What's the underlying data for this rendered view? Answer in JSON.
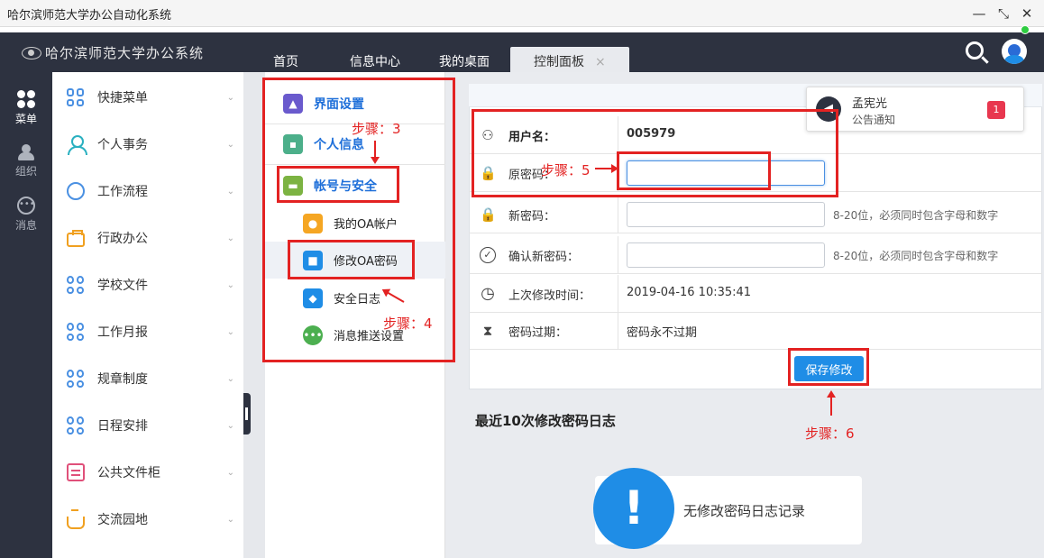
{
  "window": {
    "title": "哈尔滨师范大学办公自动化系统",
    "min_glyph": "—",
    "max_glyph": "⤡",
    "close_glyph": "✕"
  },
  "topnav": {
    "logo": "哈尔滨师范大学办公系统",
    "tabs": [
      {
        "label": "首页"
      },
      {
        "label": "信息中心"
      },
      {
        "label": "我的桌面"
      },
      {
        "label": "控制面板",
        "active": true
      }
    ],
    "tab_close_glyph": "×"
  },
  "strip": [
    {
      "label": "菜单",
      "icon": "grid-icon"
    },
    {
      "label": "组织",
      "icon": "people-icon"
    },
    {
      "label": "消息",
      "icon": "chat-icon"
    }
  ],
  "menu": {
    "items": [
      {
        "label": "快捷菜单",
        "icon": "grid-icon"
      },
      {
        "label": "个人事务",
        "icon": "person-icon"
      },
      {
        "label": "工作流程",
        "icon": "flow-icon"
      },
      {
        "label": "行政办公",
        "icon": "briefcase-icon"
      },
      {
        "label": "学校文件",
        "icon": "grid-icon"
      },
      {
        "label": "工作月报",
        "icon": "grid-icon"
      },
      {
        "label": "规章制度",
        "icon": "grid-icon"
      },
      {
        "label": "日程安排",
        "icon": "grid-icon"
      },
      {
        "label": "公共文件柜",
        "icon": "cabinet-icon"
      },
      {
        "label": "交流园地",
        "icon": "cup-icon"
      }
    ],
    "chevron": "⌄"
  },
  "subnav": {
    "sections": [
      {
        "label": "界面设置",
        "icon": "image-icon",
        "color": "#6a5acd"
      },
      {
        "label": "个人信息",
        "icon": "id-card-icon",
        "color": "#4caf8a"
      },
      {
        "label": "帐号与安全",
        "icon": "lock-bag-icon",
        "color": "#7cb342"
      }
    ],
    "items": [
      {
        "label": "我的OA帐户",
        "icon": "user-icon",
        "color": "#f5a623",
        "glyph": "👤"
      },
      {
        "label": "修改OA密码",
        "icon": "lock-icon",
        "color": "#1f8de6",
        "glyph": "🔒",
        "selected": true
      },
      {
        "label": "安全日志",
        "icon": "shield-icon",
        "color": "#1f8de6",
        "glyph": "⛨"
      },
      {
        "label": "消息推送设置",
        "icon": "message-icon",
        "color": "#4caf50",
        "glyph": "💬"
      }
    ]
  },
  "form": {
    "username": {
      "label": "用户名：",
      "value": "005979",
      "icon_glyph": "⚇"
    },
    "old_password": {
      "label": "原密码：",
      "value": "",
      "icon_glyph": "🔒"
    },
    "new_password": {
      "label": "新密码：",
      "value": "",
      "hint": "8-20位，必须同时包含字母和数字",
      "icon_glyph": "🔒"
    },
    "confirm_password": {
      "label": "确认新密码：",
      "value": "",
      "hint": "8-20位，必须同时包含字母和数字",
      "icon_glyph": "✓"
    },
    "last_modified": {
      "label": "上次修改时间：",
      "value": "2019-04-16 10:35:41",
      "icon_glyph": "◷"
    },
    "expiry": {
      "label": "密码过期：",
      "value": "密码永不过期",
      "icon_glyph": "⧗"
    },
    "save_label": "保存修改"
  },
  "log": {
    "title": "最近10次修改密码日志",
    "empty_glyph": "!",
    "empty_text": "无修改密码日志记录"
  },
  "notification": {
    "name": "孟宪光",
    "type": "公告通知",
    "count": "1",
    "speaker_glyph": "◀"
  },
  "annotations": {
    "step3": "步骤：3",
    "step4": "步骤：4",
    "step5": "步骤：5",
    "step6": "步骤：6",
    "color": "#e32222"
  }
}
